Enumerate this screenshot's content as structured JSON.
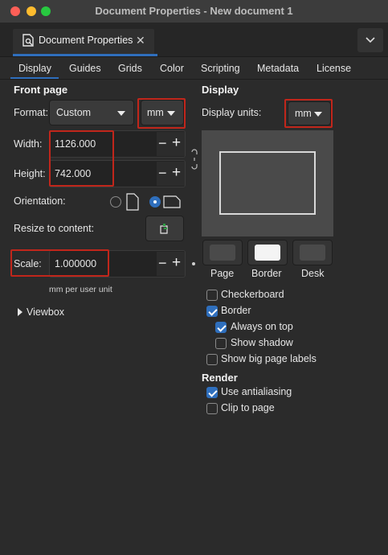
{
  "window": {
    "title": "Document Properties - New document 1"
  },
  "dock": {
    "tab_label": "Document Properties",
    "close_glyph": "✕"
  },
  "tabs": [
    "Display",
    "Guides",
    "Grids",
    "Color",
    "Scripting",
    "Metadata",
    "License"
  ],
  "front_page": {
    "title": "Front page",
    "format_label": "Format:",
    "format_value": "Custom",
    "unit_value": "mm",
    "width_label": "Width:",
    "width_value": "1126.000",
    "height_label": "Height:",
    "height_value": "742.000",
    "orientation_label": "Orientation:",
    "resize_label": "Resize to content:",
    "scale_label": "Scale:",
    "scale_value": "1.000000",
    "scale_unit_note": "mm per user unit",
    "viewbox_label": "Viewbox"
  },
  "display": {
    "title": "Display",
    "units_label": "Display units:",
    "units_value": "mm",
    "color_buttons": [
      {
        "label": "Page",
        "color": "#4a4a4a"
      },
      {
        "label": "Border",
        "color": "#f4f4f4"
      },
      {
        "label": "Desk",
        "color": "#4a4a4a"
      }
    ],
    "checkboxes": {
      "checkerboard": {
        "label": "Checkerboard",
        "checked": false
      },
      "border": {
        "label": "Border",
        "checked": true
      },
      "always_on_top": {
        "label": "Always on top",
        "checked": true
      },
      "show_shadow": {
        "label": "Show shadow",
        "checked": false
      },
      "big_labels": {
        "label": "Show big page labels",
        "checked": false
      }
    }
  },
  "render": {
    "title": "Render",
    "antialiasing": {
      "label": "Use antialiasing",
      "checked": true
    },
    "clip": {
      "label": "Clip to page",
      "checked": false
    }
  },
  "colors": {
    "accent": "#2f6fbd",
    "highlight_box": "#c1261b",
    "background": "#2b2b2b"
  }
}
